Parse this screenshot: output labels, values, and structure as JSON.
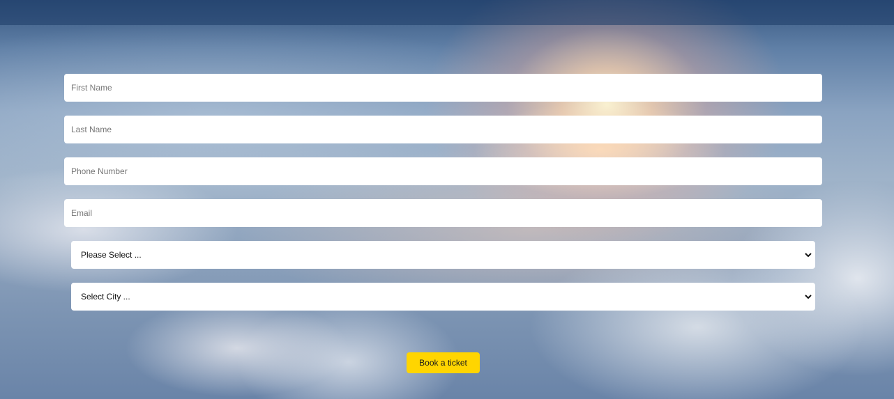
{
  "form": {
    "fields": [
      {
        "placeholder": "First Name",
        "value": ""
      },
      {
        "placeholder": "Last Name",
        "value": ""
      },
      {
        "placeholder": "Phone Number",
        "value": ""
      },
      {
        "placeholder": "Email",
        "value": ""
      }
    ],
    "selects": [
      {
        "selected": "Please Select ..."
      },
      {
        "selected": "Select City ..."
      }
    ],
    "submit_label": "Book a ticket"
  },
  "icons": {
    "select_arrow": "chevron-down-icon"
  },
  "colors": {
    "button": "#ffd500",
    "topbar": "#1c3a66",
    "field_background": "#ffffff"
  }
}
